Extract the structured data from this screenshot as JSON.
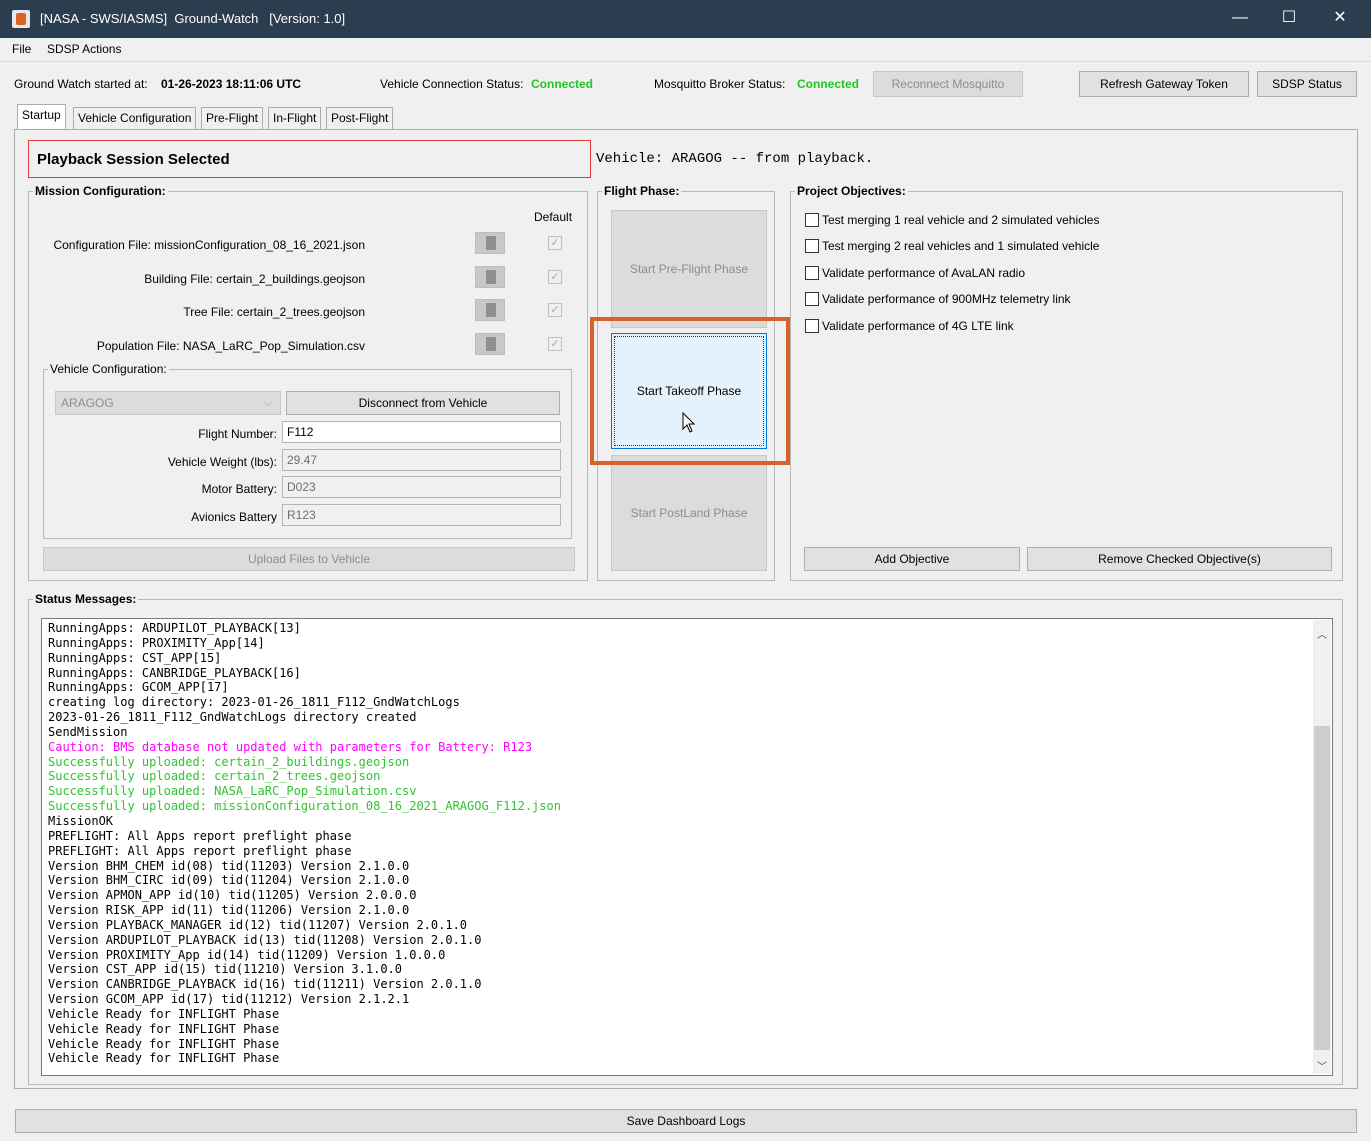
{
  "window": {
    "title": "[NASA - SWS/IASMS]  Ground-Watch   [Version: 1.0]",
    "minimize_glyph": "—",
    "maximize_glyph": "☐",
    "close_glyph": "✕"
  },
  "menu": [
    "File",
    "SDSP Actions"
  ],
  "status_bar": {
    "started_label": "Ground Watch started at:",
    "started_value": "01-26-2023 18:11:06 UTC",
    "vehicle_conn_label": "Vehicle Connection Status:",
    "vehicle_conn_value": "Connected",
    "broker_label": "Mosquitto Broker Status:",
    "broker_value": "Connected",
    "reconnect_button": "Reconnect Mosquitto",
    "refresh_button": "Refresh Gateway Token",
    "sdsp_button": "SDSP Status"
  },
  "tabs": [
    "Startup",
    "Vehicle Configuration",
    "Pre-Flight",
    "In-Flight",
    "Post-Flight"
  ],
  "session": {
    "banner": "Playback Session Selected",
    "vehicle_info": "Vehicle: ARAGOG -- from playback."
  },
  "mission": {
    "title": "Mission Configuration:",
    "default_label": "Default",
    "files": [
      {
        "label": "Configuration File: missionConfiguration_08_16_2021.json"
      },
      {
        "label": "Building File: certain_2_buildings.geojson"
      },
      {
        "label": "Tree File: certain_2_trees.geojson"
      },
      {
        "label": "Population File: NASA_LaRC_Pop_Simulation.csv"
      }
    ],
    "vehicle_config": {
      "title": "Vehicle Configuration:",
      "selected_vehicle": "ARAGOG",
      "disconnect_button": "Disconnect from Vehicle",
      "flight_number_label": "Flight Number:",
      "flight_number_value": "F112",
      "weight_label": "Vehicle Weight (lbs):",
      "weight_value": "29.47",
      "motor_label": "Motor Battery:",
      "motor_value": "D023",
      "avionics_label": "Avionics Battery",
      "avionics_value": "R123"
    },
    "upload_button": "Upload Files to Vehicle"
  },
  "flight_phase": {
    "title": "Flight Phase:",
    "preflight_button": "Start Pre-Flight Phase",
    "takeoff_button": "Start Takeoff Phase",
    "postland_button": "Start PostLand Phase",
    "highlight_color": "#d9622b"
  },
  "objectives": {
    "title": "Project Objectives:",
    "items": [
      "Test merging 1 real vehicle and 2 simulated vehicles",
      "Test merging 2 real vehicles and 1 simulated vehicle",
      "Validate performance of AvaLAN radio",
      "Validate performance of 900MHz telemetry link",
      "Validate performance of 4G LTE link"
    ],
    "add_button": "Add Objective",
    "remove_button": "Remove Checked Objective(s)"
  },
  "status_messages": {
    "title": "Status Messages:",
    "lines": [
      {
        "text": "RunningApps: ARDUPILOT_PLAYBACK[13]",
        "color": "#000000"
      },
      {
        "text": "RunningApps: PROXIMITY_App[14]",
        "color": "#000000"
      },
      {
        "text": "RunningApps: CST_APP[15]",
        "color": "#000000"
      },
      {
        "text": "RunningApps: CANBRIDGE_PLAYBACK[16]",
        "color": "#000000"
      },
      {
        "text": "RunningApps: GCOM_APP[17]",
        "color": "#000000"
      },
      {
        "text": "creating log directory: 2023-01-26_1811_F112_GndWatchLogs",
        "color": "#000000"
      },
      {
        "text": "2023-01-26_1811_F112_GndWatchLogs directory created",
        "color": "#000000"
      },
      {
        "text": "SendMission",
        "color": "#000000"
      },
      {
        "text": "Caution: BMS database not updated with parameters for Battery: R123",
        "color": "#ff00ff"
      },
      {
        "text": "Successfully uploaded: certain_2_buildings.geojson",
        "color": "#2ec52e"
      },
      {
        "text": "Successfully uploaded: certain_2_trees.geojson",
        "color": "#2ec52e"
      },
      {
        "text": "Successfully uploaded: NASA_LaRC_Pop_Simulation.csv",
        "color": "#2ec52e"
      },
      {
        "text": "Successfully uploaded: missionConfiguration_08_16_2021_ARAGOG_F112.json",
        "color": "#2ec52e"
      },
      {
        "text": "MissionOK",
        "color": "#000000"
      },
      {
        "text": "PREFLIGHT: All Apps report preflight phase",
        "color": "#000000"
      },
      {
        "text": "PREFLIGHT: All Apps report preflight phase",
        "color": "#000000"
      },
      {
        "text": "Version BHM_CHEM id(08) tid(11203) Version 2.1.0.0",
        "color": "#000000"
      },
      {
        "text": "Version BHM_CIRC id(09) tid(11204) Version 2.1.0.0",
        "color": "#000000"
      },
      {
        "text": "Version APMON_APP id(10) tid(11205) Version 2.0.0.0",
        "color": "#000000"
      },
      {
        "text": "Version RISK_APP id(11) tid(11206) Version 2.1.0.0",
        "color": "#000000"
      },
      {
        "text": "Version PLAYBACK_MANAGER id(12) tid(11207) Version 2.0.1.0",
        "color": "#000000"
      },
      {
        "text": "Version ARDUPILOT_PLAYBACK id(13) tid(11208) Version 2.0.1.0",
        "color": "#000000"
      },
      {
        "text": "Version PROXIMITY_App id(14) tid(11209) Version 1.0.0.0",
        "color": "#000000"
      },
      {
        "text": "Version CST_APP id(15) tid(11210) Version 3.1.0.0",
        "color": "#000000"
      },
      {
        "text": "Version CANBRIDGE_PLAYBACK id(16) tid(11211) Version 2.0.1.0",
        "color": "#000000"
      },
      {
        "text": "Version GCOM_APP id(17) tid(11212) Version 2.1.2.1",
        "color": "#000000"
      },
      {
        "text": "Vehicle Ready for INFLIGHT Phase",
        "color": "#000000"
      },
      {
        "text": "Vehicle Ready for INFLIGHT Phase",
        "color": "#000000"
      },
      {
        "text": "Vehicle Ready for INFLIGHT Phase",
        "color": "#000000"
      },
      {
        "text": "Vehicle Ready for INFLIGHT Phase",
        "color": "#000000"
      }
    ]
  },
  "save_button": "Save Dashboard Logs"
}
